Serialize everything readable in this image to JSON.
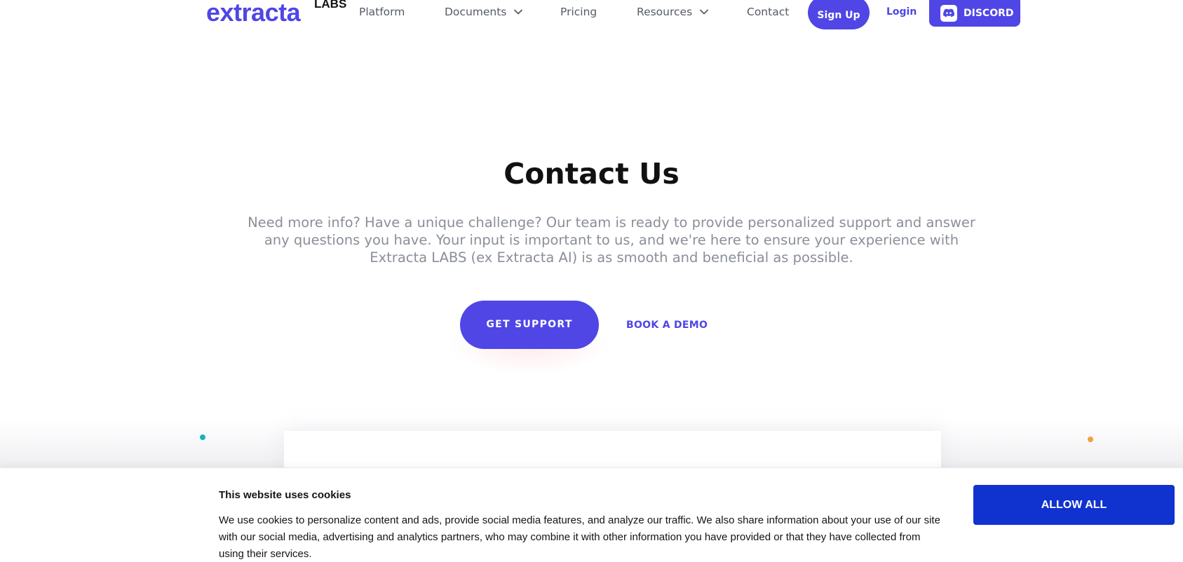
{
  "header": {
    "logo_main": "extracta",
    "logo_labs": "LABS",
    "nav": [
      {
        "label": "Platform"
      },
      {
        "label": "Documents"
      },
      {
        "label": "Pricing"
      },
      {
        "label": "Resources"
      },
      {
        "label": "Contact"
      }
    ],
    "signup_label": "Sign Up",
    "login_label": "Login",
    "discord_label": "DISCORD"
  },
  "hero": {
    "title": "Contact Us",
    "description": "Need more info? Have a unique challenge? Our team is ready to provide personalized support and answer any questions you have. Your input is important to us, and we're here to ensure your experience with Extracta LABS (ex Extracta AI) is as smooth and beneficial as possible.",
    "primary_button": "GET SUPPORT",
    "secondary_button": "BOOK A DEMO"
  },
  "cookie_banner": {
    "title": "This website uses cookies",
    "text": "We use cookies to personalize content and ads, provide social media features, and analyze our traffic. We also share information about your use of our site with our social media, advertising and analytics partners, who may combine it with other information you have provided or that they have collected from using their services.",
    "allow_label": "ALLOW ALL"
  },
  "colors": {
    "brand": "#4f46e5",
    "cookie_button": "#1032cf",
    "muted_text": "#8a8f98"
  }
}
